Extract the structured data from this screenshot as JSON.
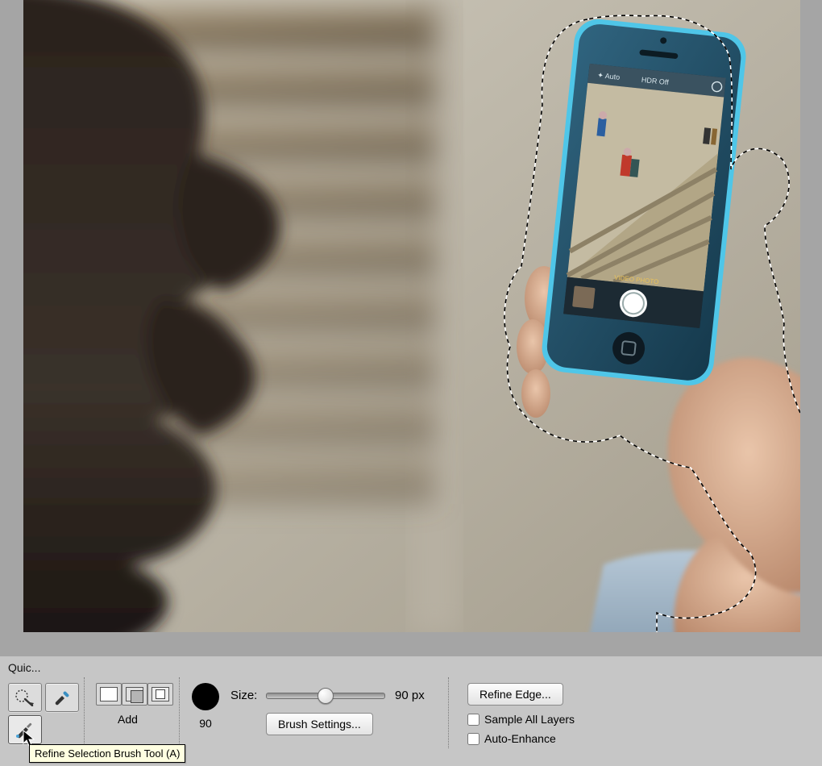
{
  "mode": {
    "label_truncated": "Quic...",
    "current": "Add"
  },
  "tools": {
    "quick_selection_name": "quick-selection-tool",
    "magic_wand_name": "magic-wand-tool",
    "refine_brush_name": "refine-selection-brush-tool",
    "tooltip": "Refine Selection Brush Tool (A)"
  },
  "brush": {
    "size_label": "Size:",
    "size_value_display": "90 px",
    "size_numeric": "90",
    "settings_btn": "Brush Settings..."
  },
  "refine": {
    "edge_btn": "Refine Edge...",
    "sample_all_layers": "Sample All Layers",
    "auto_enhance": "Auto-Enhance",
    "sample_all_layers_checked": false,
    "auto_enhance_checked": false
  },
  "canvas": {
    "description": "Photo of a person from behind holding a blue smartphone in right hand; phone and hand area has an active marquee selection (marching ants)."
  }
}
